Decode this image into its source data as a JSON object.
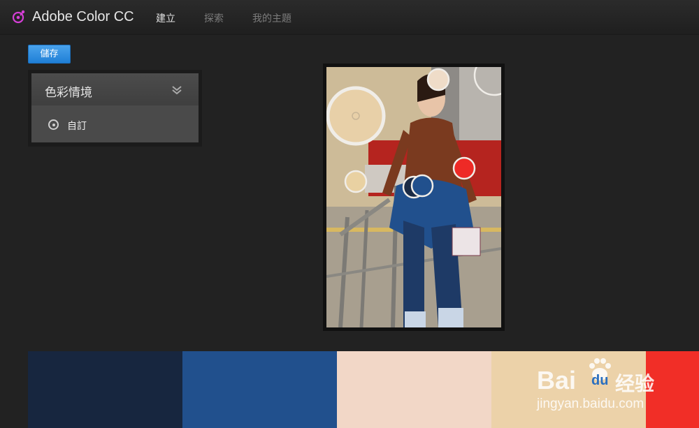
{
  "app": {
    "title": "Adobe Color CC"
  },
  "nav": {
    "create": "建立",
    "explore": "探索",
    "my_themes": "我的主題"
  },
  "toolbar": {
    "save_label": "儲存"
  },
  "mood": {
    "header": "色彩情境",
    "option": "自訂"
  },
  "swatches": [
    {
      "color": "#17263f"
    },
    {
      "color": "#21508d"
    },
    {
      "color": "#f2d7c7"
    },
    {
      "color": "#ecd2a9"
    },
    {
      "color": "#f12e27"
    }
  ],
  "watermark": {
    "brand": "Bai",
    "brand2": "du",
    "cn": "经验",
    "url": "jingyan.baidu.com"
  },
  "colors": {
    "accent": "#2a8ae0",
    "bg": "#222222",
    "panel": "#4a4a4a"
  }
}
